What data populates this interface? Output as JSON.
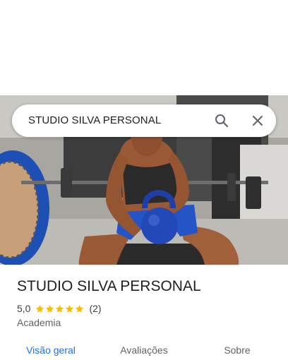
{
  "search": {
    "query": "STUDIO SILVA PERSONAL",
    "icons": [
      "search-icon",
      "close-icon"
    ]
  },
  "place": {
    "name": "STUDIO SILVA PERSONAL",
    "rating_value": "5,0",
    "rating_stars": 5,
    "review_count": "(2)",
    "category": "Academia"
  },
  "tabs": [
    {
      "label": "Visão geral",
      "active": true
    },
    {
      "label": "Avaliações",
      "active": false
    },
    {
      "label": "Sobre",
      "active": false
    }
  ],
  "colors": {
    "accent": "#1a73e8",
    "star": "#fbbc04",
    "text_primary": "#202124",
    "text_secondary": "#5f6368"
  }
}
